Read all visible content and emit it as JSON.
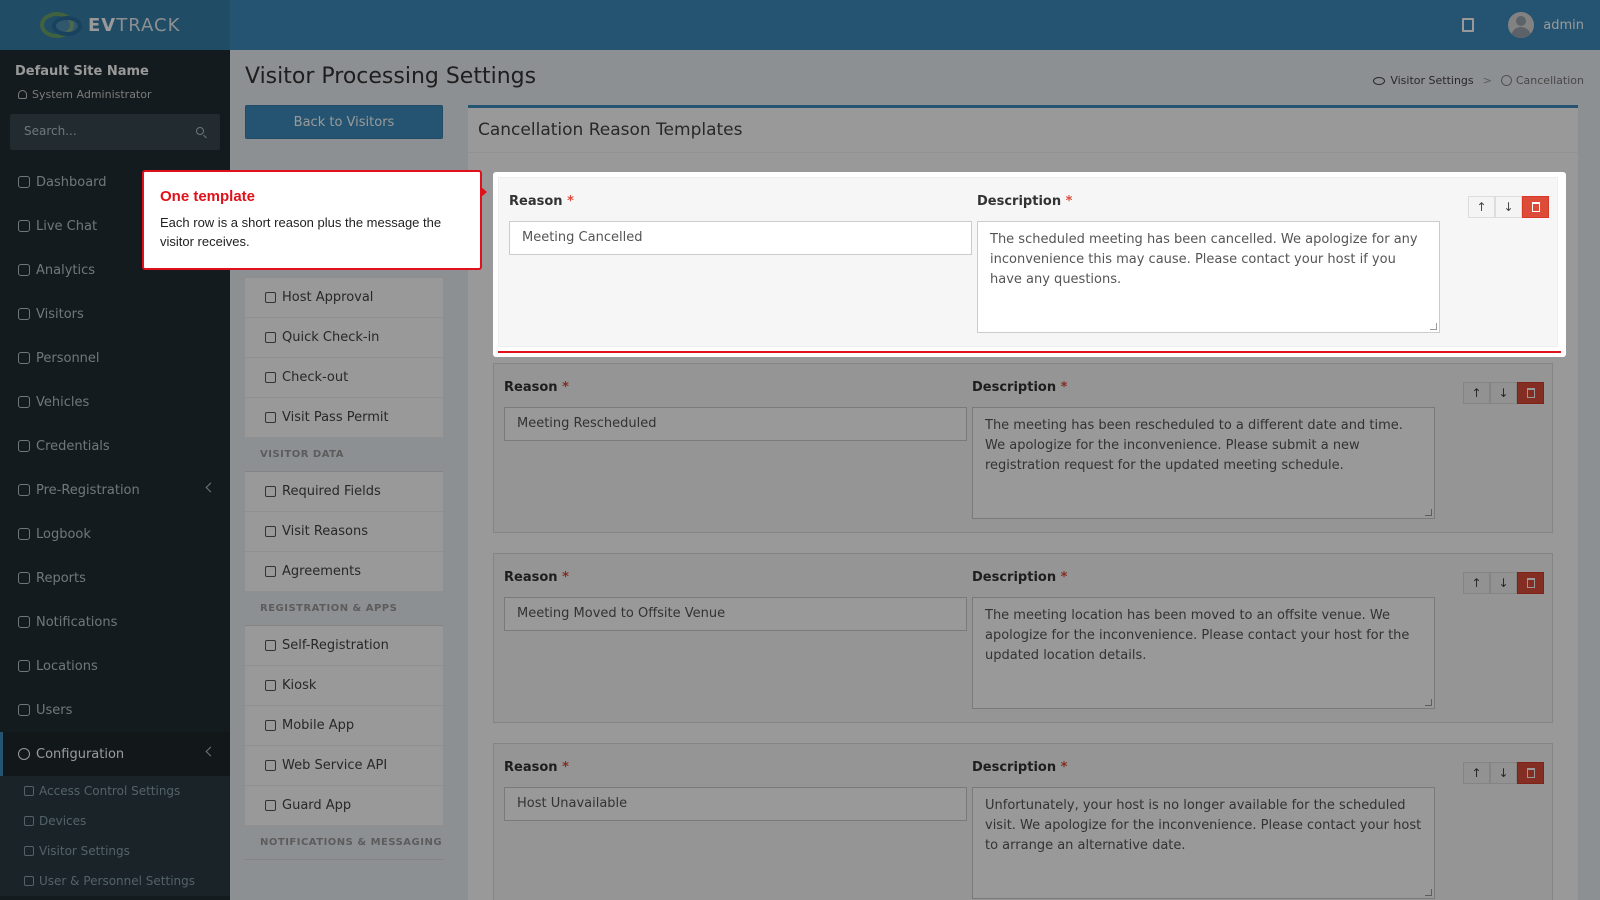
{
  "app": {
    "brand_bold": "EV",
    "brand_rest": "TRACK",
    "user": "admin"
  },
  "sidebar": {
    "site_name": "Default Site Name",
    "role": "System Administrator",
    "search_placeholder": "Search...",
    "items": [
      {
        "label": "Dashboard",
        "icon": "dashboard-icon"
      },
      {
        "label": "Live Chat",
        "icon": "headset-icon"
      },
      {
        "label": "Analytics",
        "icon": "analytics-icon"
      },
      {
        "label": "Visitors",
        "icon": "eye-icon"
      },
      {
        "label": "Personnel",
        "icon": "personnel-icon"
      },
      {
        "label": "Vehicles",
        "icon": "car-icon"
      },
      {
        "label": "Credentials",
        "icon": "badge-icon"
      },
      {
        "label": "Pre-Registration",
        "icon": "exchange-icon"
      },
      {
        "label": "Logbook",
        "icon": "book-icon"
      },
      {
        "label": "Reports",
        "icon": "reports-icon"
      },
      {
        "label": "Notifications",
        "icon": "bell-icon"
      },
      {
        "label": "Locations",
        "icon": "map-icon"
      },
      {
        "label": "Users",
        "icon": "users-icon"
      },
      {
        "label": "Configuration",
        "icon": "gear-icon"
      }
    ],
    "submenu": [
      {
        "label": "Access Control Settings",
        "icon": "lock-icon"
      },
      {
        "label": "Devices",
        "icon": "device-icon"
      },
      {
        "label": "Visitor Settings",
        "icon": "eye-icon"
      },
      {
        "label": "User & Personnel Settings",
        "icon": "user-settings-icon"
      }
    ]
  },
  "page": {
    "title": "Visitor Processing Settings",
    "breadcrumb": [
      "Visitor Settings",
      "Cancellation"
    ],
    "back_button": "Back to Visitors"
  },
  "subnav": {
    "items_top": [
      {
        "label": "Host Approval",
        "icon": "host-icon"
      },
      {
        "label": "Quick Check-in",
        "icon": "building-icon"
      },
      {
        "label": "Check-out",
        "icon": "sign-out-icon"
      },
      {
        "label": "Visit Pass Permit",
        "icon": "pass-icon"
      }
    ],
    "header_visitor_data": "VISITOR DATA",
    "items_data": [
      {
        "label": "Required Fields",
        "icon": "checklist-icon"
      },
      {
        "label": "Visit Reasons",
        "icon": "sitemap-icon"
      },
      {
        "label": "Agreements",
        "icon": "document-icon"
      }
    ],
    "header_reg_apps": "REGISTRATION & APPS",
    "items_apps": [
      {
        "label": "Self-Registration",
        "icon": "qr-icon"
      },
      {
        "label": "Kiosk",
        "icon": "monitor-icon"
      },
      {
        "label": "Mobile App",
        "icon": "mobile-icon"
      },
      {
        "label": "Web Service API",
        "icon": "api-icon"
      },
      {
        "label": "Guard App",
        "icon": "shield-icon"
      }
    ],
    "header_notifications": "NOTIFICATIONS & MESSAGING"
  },
  "panel": {
    "title": "Cancellation Reason Templates",
    "reason_label": "Reason",
    "description_label": "Description",
    "required_mark": "*",
    "templates": [
      {
        "reason": "Meeting Cancelled",
        "description": "The scheduled meeting has been cancelled. We apologize for any inconvenience this may cause. Please contact your host if you have any questions."
      },
      {
        "reason": "Meeting Rescheduled",
        "description": "The meeting has been rescheduled to a different date and time. We apologize for the inconvenience. Please submit a new registration request for the updated meeting schedule."
      },
      {
        "reason": "Meeting Moved to Offsite Venue",
        "description": "The meeting location has been moved to an offsite venue. We apologize for the inconvenience. Please contact your host for the updated location details."
      },
      {
        "reason": "Host Unavailable",
        "description": "Unfortunately, your host is no longer available for the scheduled visit. We apologize for the inconvenience. Please contact your host to arrange an alternative date."
      }
    ]
  },
  "tooltip": {
    "title": "One template",
    "body": "Each row is a short reason plus the message the visitor receives."
  },
  "colors": {
    "topbar": "#3c8dbc",
    "sidebar": "#222d32",
    "highlight": "#e0111a",
    "delete": "#dd4b39"
  }
}
